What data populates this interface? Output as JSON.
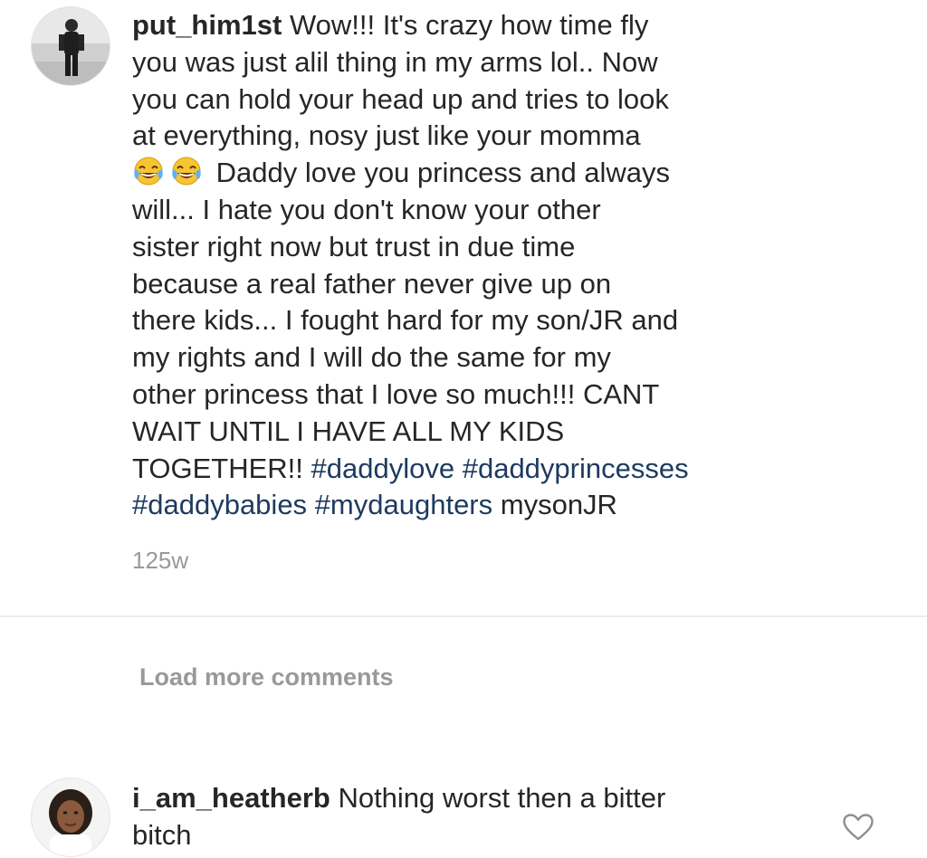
{
  "comments": [
    {
      "username": "put_him1st",
      "segments": [
        {
          "type": "text",
          "value": " Wow!!! It's crazy how time fly\nyou was just alil thing in my arms lol.. Now\nyou can hold your head up and tries to look\nat everything, nosy just like your momma\n"
        },
        {
          "type": "emoji",
          "icon": "tears-of-joy-emoji-icon"
        },
        {
          "type": "emoji",
          "icon": "tears-of-joy-emoji-icon"
        },
        {
          "type": "text",
          "value": " Daddy love you princess and always\nwill... I hate you don't know your other\nsister right now  but trust in due time\nbecause a real father never give up on\nthere kids... I fought hard for my son/JR and\nmy rights and I will do the same for my\nother princess that I love so much!!! CANT\nWAIT UNTIL I HAVE ALL MY KIDS\nTOGETHER!! "
        },
        {
          "type": "hashtag",
          "value": "#daddylove"
        },
        {
          "type": "text",
          "value": " "
        },
        {
          "type": "hashtag",
          "value": "#daddyprincesses"
        },
        {
          "type": "text",
          "value": "\n"
        },
        {
          "type": "hashtag",
          "value": "#daddybabies"
        },
        {
          "type": "text",
          "value": " "
        },
        {
          "type": "hashtag",
          "value": "#mydaughters"
        },
        {
          "type": "text",
          "value": " mysonJR"
        }
      ],
      "timestamp": "125w",
      "avatar_icon": "user-avatar-man-standing"
    },
    {
      "username": "i_am_heatherb",
      "text": " Nothing worst then a bitter\nbitch",
      "avatar_icon": "user-avatar-woman-selfie"
    }
  ],
  "load_more_label": "Load more comments",
  "icons": {
    "like": "heart-outline-icon"
  },
  "colors": {
    "text": "#262626",
    "muted": "#999999",
    "hashtag": "#1e3a5f",
    "divider": "#ececec"
  }
}
